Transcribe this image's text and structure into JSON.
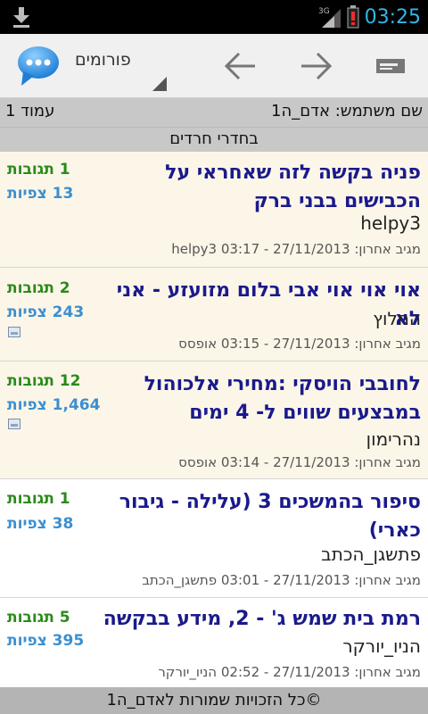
{
  "status_bar": {
    "time": "03:25",
    "network": "3G",
    "icons": [
      "download-icon",
      "signal-icon",
      "battery-alert-icon"
    ],
    "accent_color": "#33b5e5"
  },
  "action_bar": {
    "title": "פורומים",
    "icons": [
      "chat-bubble-icon",
      "back-arrow-icon",
      "forward-arrow-icon",
      "menu-icon"
    ]
  },
  "user_bar": {
    "username_label": "שם משתמש: אדם_ה1",
    "page_label": "עמוד 1"
  },
  "forum_bar": {
    "forum_name": "בחדרי חרדים"
  },
  "topics": [
    {
      "title": "פניה בקשה לזה שאחראי על הכבישים בבני ברק",
      "author": "helpy3",
      "last_post": "מגיב אחרון: 27/11/2013 - 03:17 helpy3",
      "replies": "1 תגובות",
      "views": "13 צפיות"
    },
    {
      "title": "אוי אוי אוי אבי בלום מזועזע - אני לא",
      "author": "החלוץ",
      "last_post": "מגיב אחרון: 27/11/2013 - 03:15 אופסס",
      "replies": "2 תגובות",
      "views": "243 צפיות"
    },
    {
      "title": "לחובבי הויסקי :מחירי אלכוהול במבצעים שווים ל- 4 ימים",
      "author": "נהרימון",
      "last_post": "מגיב אחרון: 27/11/2013 - 03:14 אופסס",
      "replies": "12 תגובות",
      "views": "1,464 צפיות"
    },
    {
      "title": "סיפור בהמשכים 3 (עלילה - גיבור כארי)",
      "author": "פתשגן_הכתב",
      "last_post": "מגיב אחרון: 27/11/2013 - 03:01 פתשגן_הכתב",
      "replies": "1 תגובות",
      "views": "38 צפיות"
    },
    {
      "title": "רמת בית שמש ג' - 2, מידע בבקשה",
      "author": "הניו_יורקר",
      "last_post": "מגיב אחרון: 27/11/2013 - 02:52 הניו_יורקר",
      "replies": "5 תגובות",
      "views": "395 צפיות"
    }
  ],
  "footer": {
    "copyright": "©כל הזכויות שמורות לאדם_ה1"
  }
}
